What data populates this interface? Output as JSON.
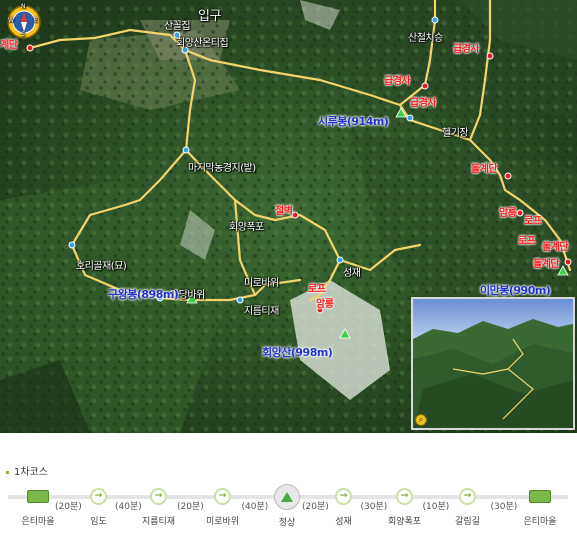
{
  "map": {
    "entrance_label": "입구",
    "places": {
      "sanbulgu": "산꼴집",
      "huiyangsan_ontijip": "회양산온티집",
      "sancheolchiseung": "산철치승",
      "majimak_nongga": "마지막농경지(밭)",
      "hwangbunjang": "헬기장",
      "huiyang_pokpo": "회양폭포",
      "horangi_goljae": "호리골재(묘)",
      "madang_bawi": "마당바위",
      "miro_bawi": "미로바위",
      "jireum_tije": "지름티재",
      "seongjae": "성재",
      "west_edge": "계단"
    },
    "hazards": {
      "geupgyeongsa_1": "급경사",
      "geupgyeongsa_2": "급경사",
      "geupgyeongsa_3": "급경사",
      "dolgyedan_1": "돌계단",
      "amnyeong_1": "암릉",
      "rope_1": "로프",
      "rope_2": "로프",
      "dolgyedan_2": "돌계단",
      "dolgyedan_3": "돌계단",
      "jeolbyeok": "절벽",
      "rope_3": "로프",
      "amnyeong_2": "암릉"
    },
    "peaks": {
      "samubong": "시루봉(914m)",
      "imanbong": "이만봉(990m)",
      "gurwangbong": "구왕봉(898m)",
      "huiyangsan": "회양산(998m)"
    },
    "compass_letters": {
      "n": "N",
      "s": "S",
      "w": "W",
      "e": "E"
    }
  },
  "course": {
    "title": "1차코스",
    "stops": [
      "은티마을",
      "임도",
      "지름티재",
      "미로바위",
      "정상",
      "성재",
      "회양폭포",
      "갈림길",
      "은티마을"
    ],
    "durations": [
      "(20분)",
      "(40분)",
      "(20분)",
      "(40분)",
      "(20분)",
      "(30분)",
      "(10분)",
      "(30분)"
    ]
  },
  "colors": {
    "trail": "#f2d46a",
    "hazard_text": "#ff1a1a",
    "peak_text": "#2233cc",
    "course_accent": "#7ab84a"
  }
}
